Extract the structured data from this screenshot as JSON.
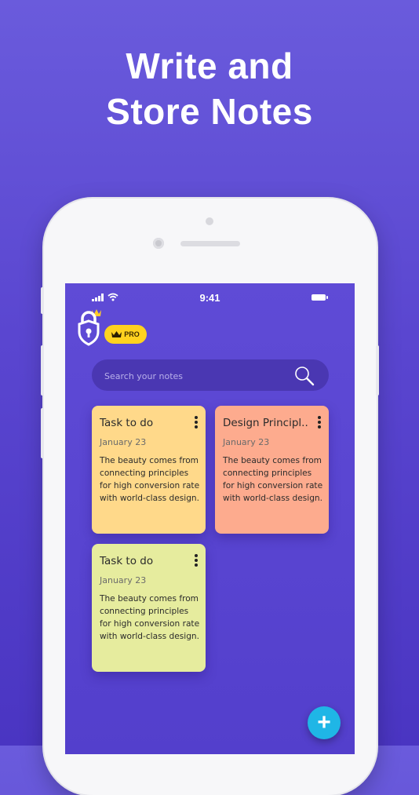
{
  "headline": {
    "line1": "Write and",
    "line2": "Store Notes"
  },
  "status_bar": {
    "time": "9:41"
  },
  "app": {
    "pro_badge": "PRO"
  },
  "search": {
    "placeholder": "Search your notes"
  },
  "notes": [
    {
      "title": "Task to do",
      "date": "January 23",
      "body": "The beauty comes from connecting principles for high conversion rate with world-class design.",
      "color": "#ffd98a"
    },
    {
      "title": "Design Principl..",
      "date": "January 23",
      "body": "The beauty comes from connecting principles for high conversion rate with world-class design.",
      "color": "#fdab8e"
    },
    {
      "title": "Task to do",
      "date": "January 23",
      "body": "The beauty comes from connecting principles for high conversion rate with world-class design.",
      "color": "#e6ec9e"
    }
  ],
  "fab": {
    "label": "+"
  },
  "icons": {
    "search": "search-icon",
    "more": "more-vertical-icon",
    "add": "plus-icon",
    "logo": "lock-shield-logo",
    "crown": "crown-icon"
  }
}
